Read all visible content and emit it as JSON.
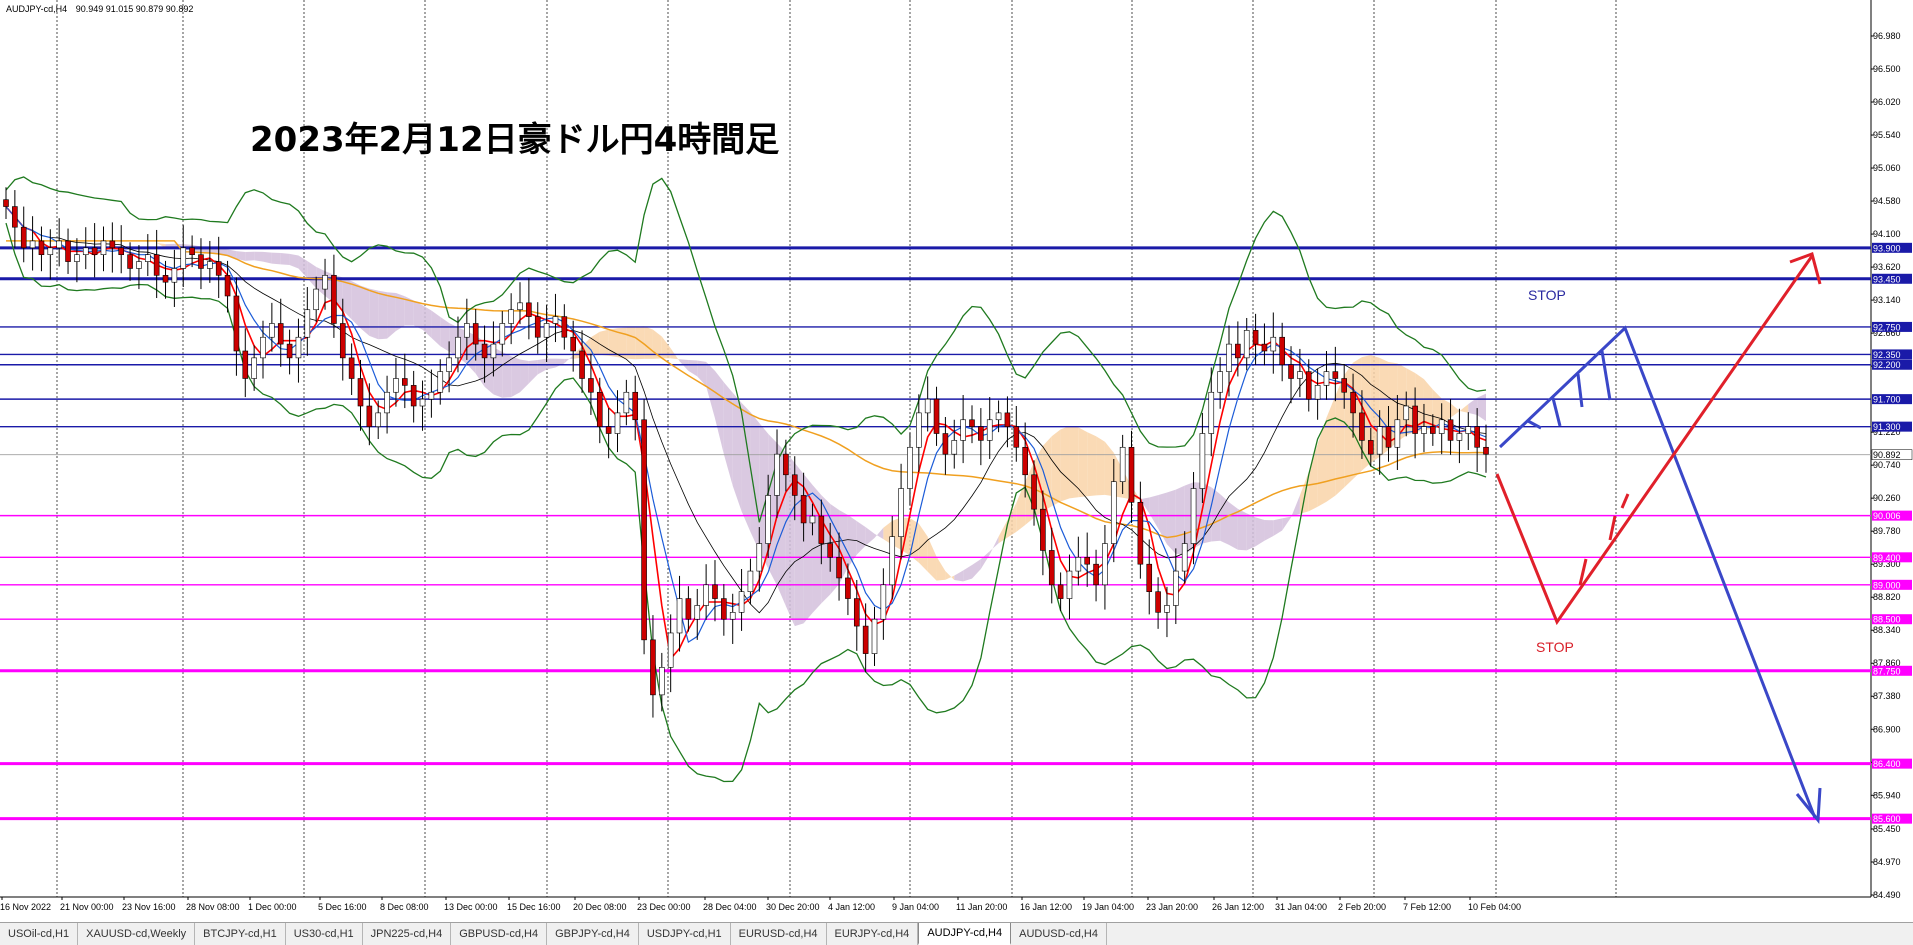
{
  "window": {
    "symbol_tf": "AUDJPY-cd,H4",
    "ohlc": "90.949 91.015 90.879 90.892"
  },
  "heading": "2023年2月12日豪ドル円4時間足",
  "annotations": {
    "stop_upper": "STOP",
    "stop_lower": "STOP"
  },
  "colors": {
    "support_line": "#ff00ff",
    "resistance_line": "#1a1aa8",
    "bullish_scenario": "#e0202a",
    "bearish_scenario": "#3a47c8",
    "ma_long": "#f0a020",
    "bollinger": "#1f7a1f",
    "kumo_bull": "#f9d3a8",
    "kumo_bear": "#d4bfdc",
    "price_tag_text": "#ffffff"
  },
  "tabs": [
    {
      "label": "USOil-cd,H1",
      "active": false
    },
    {
      "label": "XAUUSD-cd,Weekly",
      "active": false
    },
    {
      "label": "BTCJPY-cd,H1",
      "active": false
    },
    {
      "label": "US30-cd,H1",
      "active": false
    },
    {
      "label": "JPN225-cd,H4",
      "active": false
    },
    {
      "label": "GBPUSD-cd,H4",
      "active": false
    },
    {
      "label": "GBPJPY-cd,H4",
      "active": false
    },
    {
      "label": "USDJPY-cd,H1",
      "active": false
    },
    {
      "label": "EURUSD-cd,H4",
      "active": false
    },
    {
      "label": "EURJPY-cd,H4",
      "active": false
    },
    {
      "label": "AUDJPY-cd,H4",
      "active": true
    },
    {
      "label": "AUDUSD-cd,H4",
      "active": false
    }
  ],
  "chart_data": {
    "type": "candlestick",
    "symbol": "AUDJPY-cd,H4",
    "y_axis_ticks": [
      "96.980",
      "96.500",
      "96.020",
      "95.540",
      "95.060",
      "94.580",
      "94.100",
      "93.620",
      "93.140",
      "92.660",
      "92.180",
      "91.220",
      "90.740",
      "90.260",
      "89.780",
      "89.300",
      "88.820",
      "88.340",
      "87.860",
      "87.380",
      "86.900",
      "86.420",
      "85.940",
      "85.450",
      "84.970",
      "84.490"
    ],
    "x_axis_ticks": [
      "16 Nov 2022",
      "21 Nov 00:00",
      "23 Nov 16:00",
      "28 Nov 08:00",
      "1 Dec 00:00",
      "5 Dec 16:00",
      "8 Dec 08:00",
      "13 Dec 00:00",
      "15 Dec 16:00",
      "20 Dec 08:00",
      "23 Dec 00:00",
      "28 Dec 04:00",
      "30 Dec 20:00",
      "4 Jan 12:00",
      "9 Jan 04:00",
      "11 Jan 20:00",
      "16 Jan 12:00",
      "19 Jan 04:00",
      "23 Jan 20:00",
      "26 Jan 12:00",
      "31 Jan 04:00",
      "2 Feb 20:00",
      "7 Feb 12:00",
      "10 Feb 04:00"
    ],
    "horizontal_levels": [
      {
        "price": 93.9,
        "label": "93.900",
        "kind": "resistance",
        "thick": true
      },
      {
        "price": 93.45,
        "label": "93.450",
        "kind": "resistance",
        "thick": true
      },
      {
        "price": 92.75,
        "label": "92.750",
        "kind": "resistance",
        "thick": false
      },
      {
        "price": 92.35,
        "label": "92.350",
        "kind": "resistance",
        "thick": false
      },
      {
        "price": 92.2,
        "label": "92.200",
        "kind": "resistance",
        "thick": false
      },
      {
        "price": 91.7,
        "label": "91.700",
        "kind": "resistance",
        "thick": false
      },
      {
        "price": 91.3,
        "label": "91.300",
        "kind": "resistance",
        "thick": false
      },
      {
        "price": 90.006,
        "label": "90.006",
        "kind": "support",
        "thick": false
      },
      {
        "price": 89.4,
        "label": "89.400",
        "kind": "support",
        "thick": false
      },
      {
        "price": 89.0,
        "label": "89.000",
        "kind": "support",
        "thick": false
      },
      {
        "price": 88.5,
        "label": "88.500",
        "kind": "support",
        "thick": false
      },
      {
        "price": 87.75,
        "label": "87.750",
        "kind": "support",
        "thick": true
      },
      {
        "price": 86.4,
        "label": "86.400",
        "kind": "support",
        "thick": true
      },
      {
        "price": 85.6,
        "label": "85.600",
        "kind": "support",
        "thick": true
      }
    ],
    "current_price": {
      "price": 90.892,
      "label": "90.892"
    },
    "closes": [
      94.5,
      94.2,
      93.9,
      94.0,
      93.8,
      93.9,
      94.0,
      93.7,
      93.8,
      93.9,
      93.8,
      94.0,
      93.9,
      93.8,
      93.6,
      93.7,
      93.8,
      93.5,
      93.4,
      93.6,
      93.9,
      93.8,
      93.6,
      93.7,
      93.5,
      93.2,
      92.4,
      92.0,
      92.3,
      92.6,
      92.8,
      92.5,
      92.3,
      92.6,
      93.0,
      93.3,
      93.5,
      92.8,
      92.3,
      92.0,
      91.6,
      91.3,
      91.5,
      91.8,
      92.0,
      91.9,
      91.6,
      91.7,
      91.8,
      92.1,
      92.3,
      92.6,
      92.8,
      92.5,
      92.3,
      92.5,
      92.8,
      93.0,
      93.1,
      92.9,
      92.6,
      92.8,
      92.9,
      92.6,
      92.4,
      92.0,
      91.8,
      91.3,
      91.2,
      91.5,
      91.8,
      91.4,
      88.2,
      87.4,
      87.8,
      88.3,
      88.8,
      88.5,
      88.7,
      89.0,
      88.8,
      88.5,
      88.6,
      88.9,
      89.2,
      89.6,
      90.3,
      90.9,
      90.6,
      90.3,
      89.9,
      90.0,
      89.6,
      89.4,
      89.1,
      88.8,
      88.4,
      88.0,
      88.5,
      89.0,
      89.7,
      90.4,
      91.0,
      91.5,
      91.7,
      91.2,
      90.9,
      91.1,
      91.4,
      91.3,
      91.1,
      91.4,
      91.5,
      91.3,
      91.0,
      90.6,
      90.1,
      89.5,
      89.0,
      88.8,
      89.2,
      89.4,
      89.3,
      89.0,
      89.6,
      90.5,
      91.0,
      90.2,
      89.3,
      88.9,
      88.6,
      88.7,
      89.2,
      89.6,
      90.4,
      91.2,
      91.8,
      92.1,
      92.5,
      92.3,
      92.7,
      92.5,
      92.4,
      92.6,
      92.2,
      92.0,
      92.1,
      91.7,
      91.9,
      92.1,
      92.0,
      91.8,
      91.5,
      91.1,
      90.9,
      91.3,
      91.0,
      91.4,
      91.6,
      91.2,
      91.3,
      91.2,
      91.4,
      91.1,
      91.2,
      91.3,
      91.0,
      90.9
    ]
  }
}
